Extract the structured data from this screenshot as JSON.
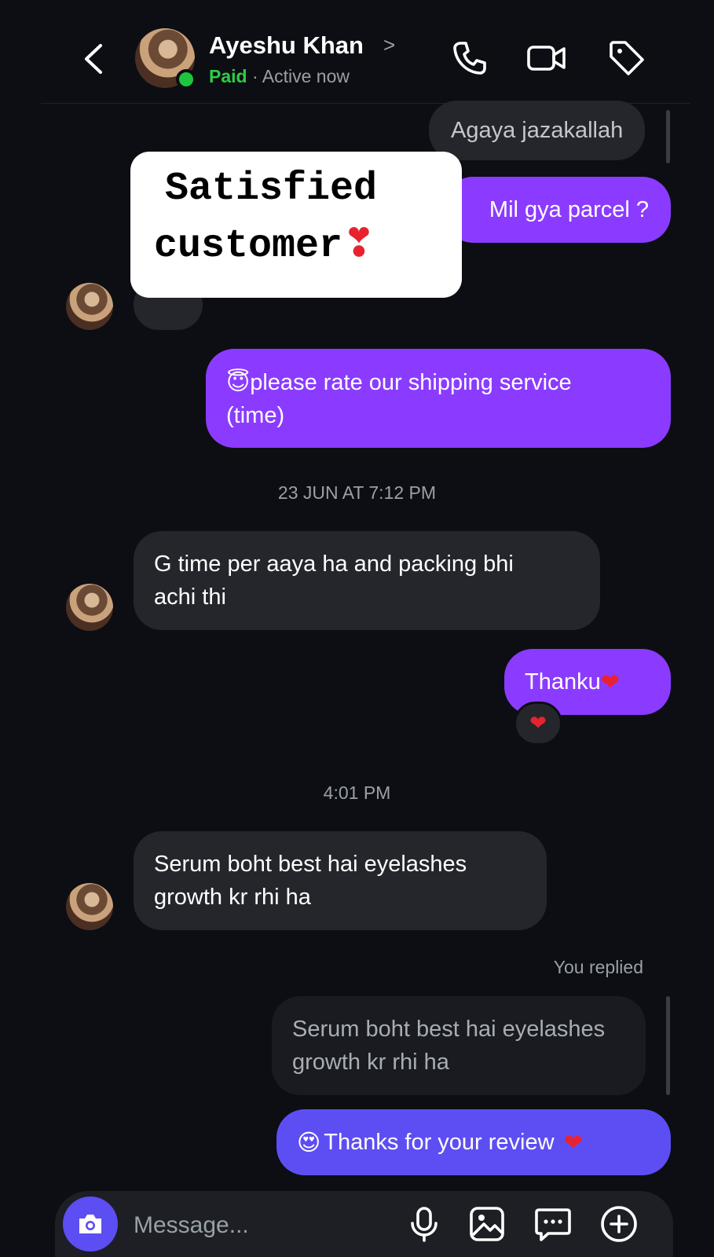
{
  "header": {
    "name": "Ayeshu Khan",
    "status_label": "Paid",
    "separator": "·",
    "activity": "Active now"
  },
  "overlay": {
    "line1": "Satisfied",
    "line2": "customer",
    "emoji": "❣"
  },
  "messages": {
    "m1": "Agaya jazakallah",
    "m2": "Mil gya parcel ?",
    "m3_emoji": "😇",
    "m3_line1": "please rate our shipping service",
    "m3_line2": "(time)",
    "ts1": "23 JUN AT 7:12 PM",
    "m4_line1": "G time per aaya ha and packing bhi",
    "m4_line2": "achi thi",
    "m5": "Thanku",
    "m5_heart": "❤",
    "reaction": "❤",
    "ts2": "4:01 PM",
    "m6_line1": "Serum boht best hai eyelashes",
    "m6_line2": "growth kr rhi ha",
    "replied_label": "You replied",
    "q_line1": "Serum boht best hai eyelashes",
    "q_line2": "growth kr rhi ha",
    "m7_emoji": "😍",
    "m7": "Thanks for your review",
    "m7_heart": "❤"
  },
  "composer": {
    "placeholder": "Message..."
  },
  "icons": {
    "back": "chevron-left-icon",
    "call": "phone-icon",
    "video": "video-camera-icon",
    "tag": "tag-icon",
    "camera": "camera-icon",
    "mic": "microphone-icon",
    "gallery": "image-icon",
    "sticker": "chat-bubble-icon",
    "add": "plus-circle-icon"
  },
  "colors": {
    "outgoing": "#8b3bff",
    "outgoing_latest": "#5d4ef3",
    "incoming": "#24262c",
    "online": "#1fc43d",
    "background": "#0c0e13"
  }
}
